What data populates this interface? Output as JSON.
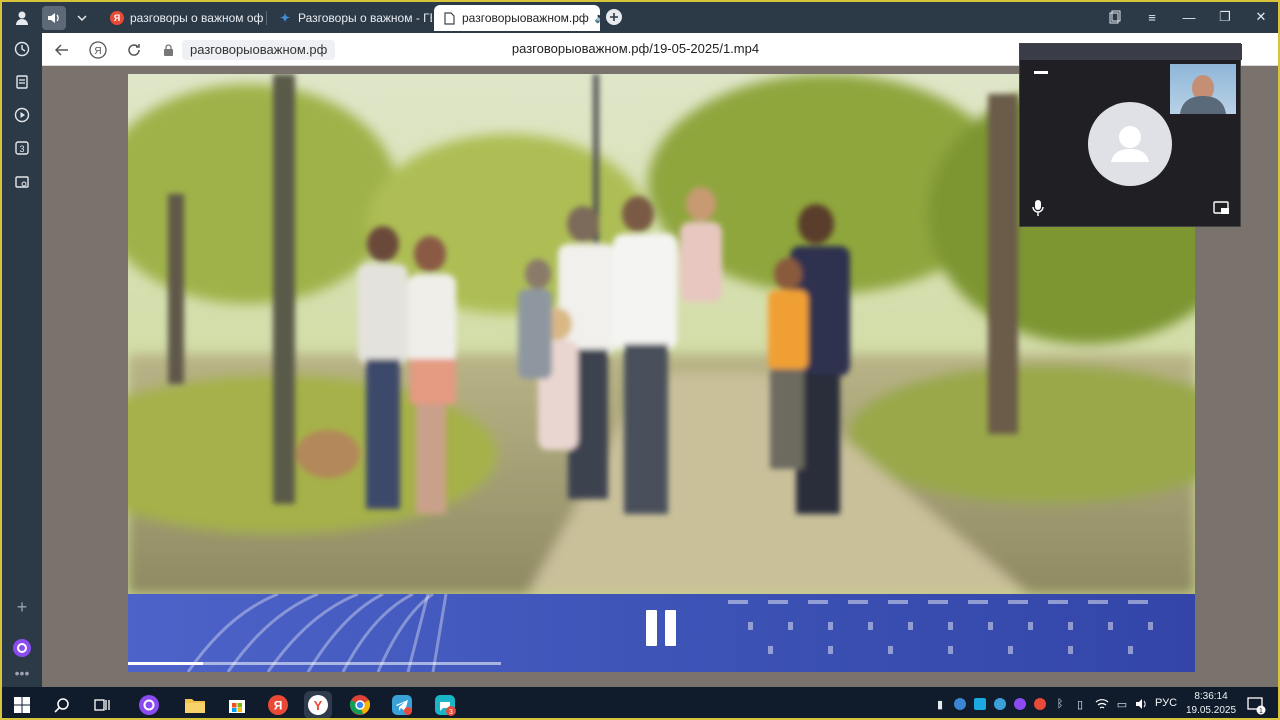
{
  "browser": {
    "tabs": [
      {
        "title": "разговоры о важном офи",
        "favicon": "yandex-icon",
        "color": "#e94a35"
      },
      {
        "title": "Разговоры о важном - ГБ",
        "favicon": "star-icon",
        "color": "#3e8ed8"
      },
      {
        "title": "разговорыоважном.рф",
        "favicon": "document-icon",
        "color": "#555555",
        "active": true
      }
    ],
    "address": {
      "domain": "разговорыоважном.рф",
      "url": "разговорыоважном.рф/19-05-2025/1.mp4"
    }
  },
  "video": {
    "state": "playing",
    "progress_fraction": 0.07,
    "buffered_fraction": 0.35
  },
  "call_window": {
    "self_video": "participant-thumbnail"
  },
  "taskbar": {
    "language": "РУС",
    "time": "8:36:14",
    "date": "19.05.2025",
    "notification_count": "1"
  },
  "colors": {
    "accent_frame": "#d8c43a",
    "video_bar": "#3f55b8",
    "tab_strip": "#2c3947",
    "taskbar": "#101c2c"
  }
}
